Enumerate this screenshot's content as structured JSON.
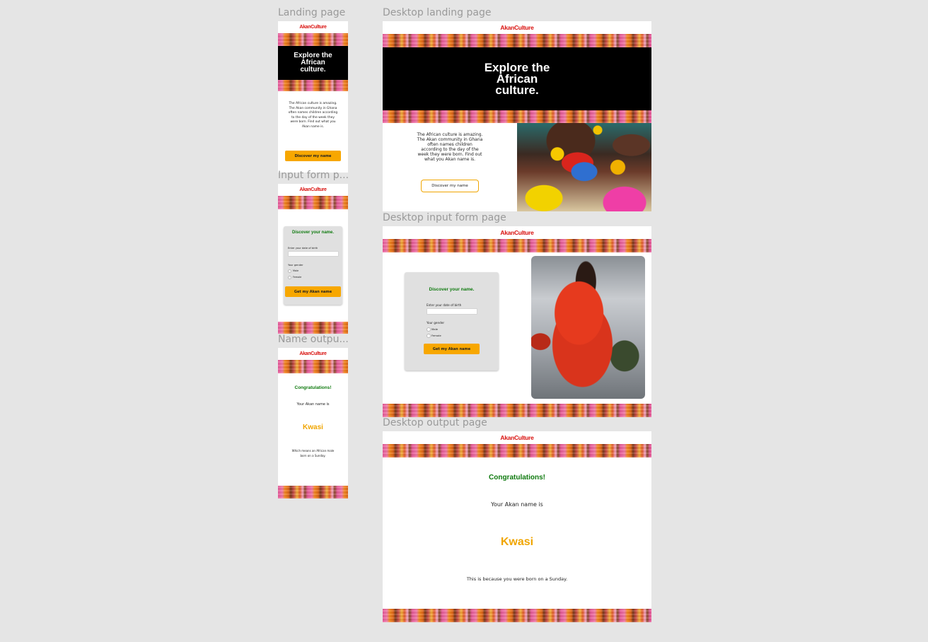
{
  "frames": {
    "mobile_landing": "Landing page",
    "mobile_input": "Input form p...",
    "mobile_output": "Name outpu...",
    "desktop_landing": "Desktop landing page",
    "desktop_input": "Desktop input form page",
    "desktop_output": "Desktop output page"
  },
  "brand": "AkanCulture",
  "hero": {
    "line1": "Explore the",
    "line2": "African",
    "line3": "culture."
  },
  "intro_mobile": "The African culture is amazing. The Akan community in Ghana often names children according to the day of the week they were born. Find out what you Akan name is.",
  "intro_desktop": "The African culture is amazing. The Akan community in Ghana often names children according to the day of the week they were born. Find out what you Akan name is.",
  "discover_button": "Discover my name",
  "form": {
    "title": "Discover your name.",
    "dob_label": "Enter your date of birth",
    "gender_label": "Your gender",
    "male": "Male",
    "female": "Female",
    "submit": "Get my Akan name"
  },
  "output": {
    "congrats": "Congratulations!",
    "intro": "Your Akan name is",
    "name": "Kwasi",
    "mobile_reason": "Which means an African male born on a Sunday.",
    "desktop_reason": "This is because you were born on a Sunday."
  },
  "colors": {
    "brand": "#d9120f",
    "accent": "#f7a700",
    "green": "#0f7a0f",
    "canvas": "#e5e5e5"
  }
}
